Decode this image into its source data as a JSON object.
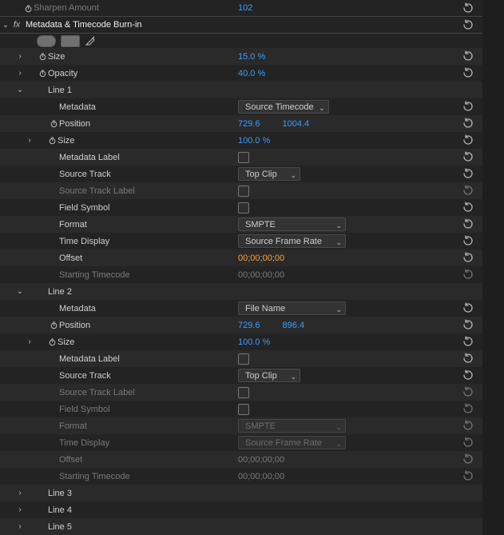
{
  "topStub": {
    "label": "Sharpen Amount",
    "value": "102"
  },
  "effect": {
    "name": "Metadata & Timecode Burn-in"
  },
  "size": {
    "label": "Size",
    "value": "15.0 %"
  },
  "opacity": {
    "label": "Opacity",
    "value": "40.0 %"
  },
  "line1": {
    "label": "Line 1",
    "metadata": {
      "label": "Metadata",
      "value": "Source Timecode"
    },
    "position": {
      "label": "Position",
      "x": "729.6",
      "y": "1004.4"
    },
    "size": {
      "label": "Size",
      "value": "100.0 %"
    },
    "metadataLabel": {
      "label": "Metadata Label"
    },
    "sourceTrack": {
      "label": "Source Track",
      "value": "Top Clip"
    },
    "sourceTrackLabel": {
      "label": "Source Track Label"
    },
    "fieldSymbol": {
      "label": "Field Symbol"
    },
    "format": {
      "label": "Format",
      "value": "SMPTE"
    },
    "timeDisplay": {
      "label": "Time Display",
      "value": "Source Frame Rate"
    },
    "offset": {
      "label": "Offset",
      "value": "00;00;00;00"
    },
    "startingTimecode": {
      "label": "Starting Timecode",
      "value": "00;00;00;00"
    }
  },
  "line2": {
    "label": "Line 2",
    "metadata": {
      "label": "Metadata",
      "value": "File Name"
    },
    "position": {
      "label": "Position",
      "x": "729.6",
      "y": "896.4"
    },
    "size": {
      "label": "Size",
      "value": "100.0 %"
    },
    "metadataLabel": {
      "label": "Metadata Label"
    },
    "sourceTrack": {
      "label": "Source Track",
      "value": "Top Clip"
    },
    "sourceTrackLabel": {
      "label": "Source Track Label"
    },
    "fieldSymbol": {
      "label": "Field Symbol"
    },
    "format": {
      "label": "Format",
      "value": "SMPTE"
    },
    "timeDisplay": {
      "label": "Time Display",
      "value": "Source Frame Rate"
    },
    "offset": {
      "label": "Offset",
      "value": "00;00;00;00"
    },
    "startingTimecode": {
      "label": "Starting Timecode",
      "value": "00;00;00;00"
    }
  },
  "line3": {
    "label": "Line 3"
  },
  "line4": {
    "label": "Line 4"
  },
  "line5": {
    "label": "Line 5"
  },
  "selectWidths": {
    "wide": "135px",
    "narrow": "78px"
  }
}
